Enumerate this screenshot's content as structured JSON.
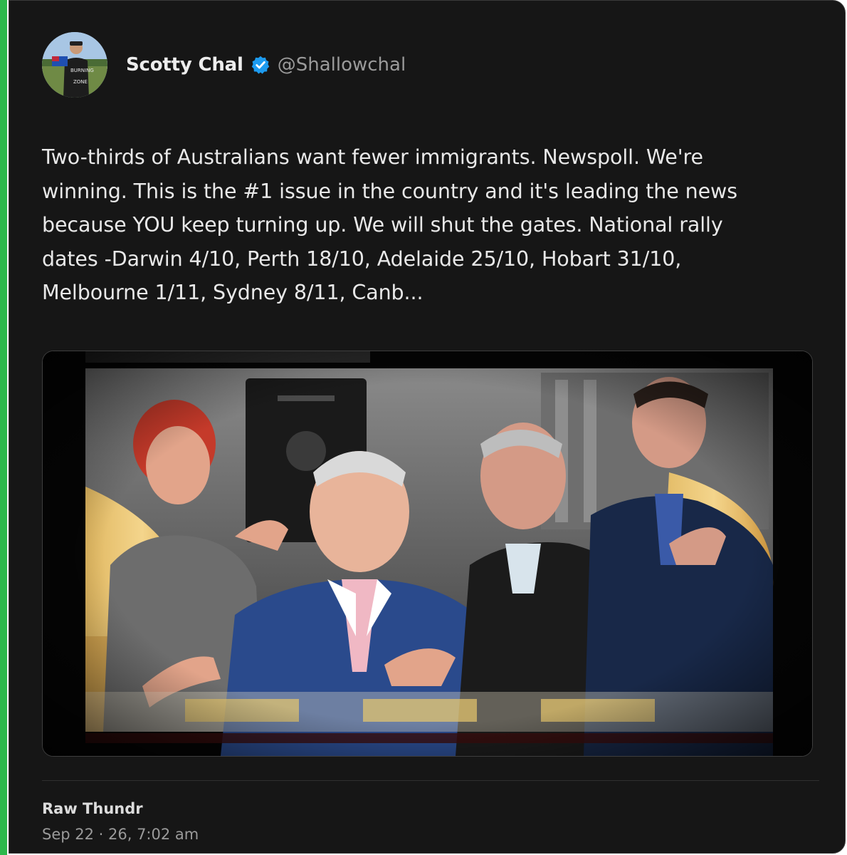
{
  "post": {
    "author_name": "Scotty Chal",
    "author_handle": "@Shallowchal",
    "verified": true,
    "text": "Two-thirds of Australians want fewer immigrants. Newspoll. We're winning. This is the #1 issue in the country and it's leading the news because YOU keep turning up. We will shut the gates. National rally dates -Darwin 4/10, Perth 18/10, Adelaide 25/10, Hobart 31/10, Melbourne 1/11, Sydney 8/11, Canb...",
    "source": "Raw Thundr",
    "timestamp": "Sep 22 · 26, 7:02 am"
  },
  "colors": {
    "page_accent": "#2db84c",
    "card_background": "#161616",
    "verified_badge": "#1d9bf0"
  },
  "icons": {
    "verified": "verified-badge-icon"
  }
}
